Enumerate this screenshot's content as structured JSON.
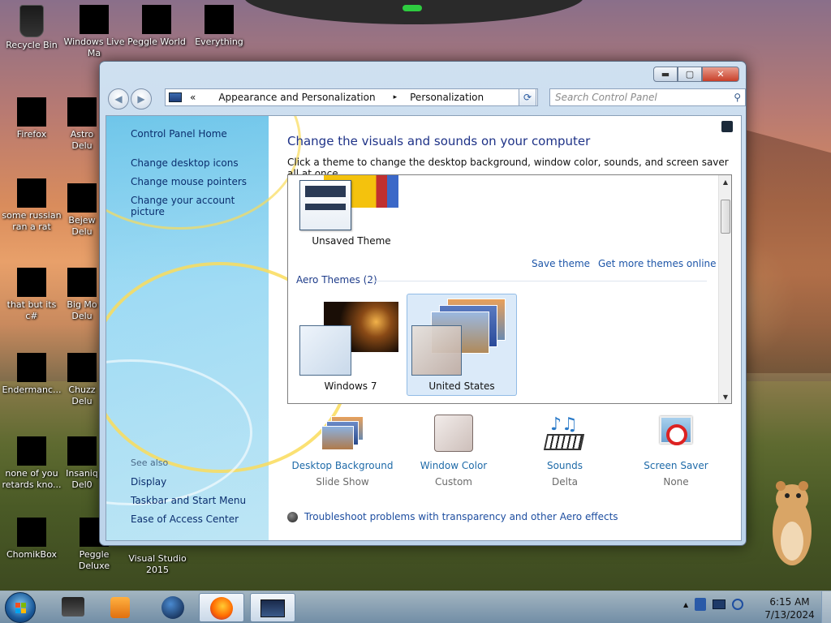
{
  "desktop": {
    "icons": [
      {
        "label": "Recycle Bin"
      },
      {
        "label": "Windows Live Ma"
      },
      {
        "label": "Peggle World"
      },
      {
        "label": "Everything"
      },
      {
        "label": "Firefox"
      },
      {
        "label": "Astro Delu"
      },
      {
        "label": "some russian ran a rat"
      },
      {
        "label": "Bejew Delu"
      },
      {
        "label": "that but its c#"
      },
      {
        "label": "Big Mo Delu"
      },
      {
        "label": "Endermanc..."
      },
      {
        "label": "Chuzz Delu"
      },
      {
        "label": "none of you retards kno..."
      },
      {
        "label": "Insaniq Del0"
      },
      {
        "label": "ChomikBox"
      },
      {
        "label": "Peggle Deluxe"
      },
      {
        "label": "Visual Studio 2015"
      }
    ]
  },
  "window": {
    "controls": {
      "minimize": "▬",
      "maximize": "▢",
      "close": "✕"
    },
    "nav": {
      "back": "◀",
      "forward": "▶"
    },
    "address": {
      "overflow": "«",
      "crumb1": "Appearance and Personalization",
      "sep": "▸",
      "crumb2": "Personalization",
      "dropdown": "▼"
    },
    "refresh": "⟳",
    "search": {
      "placeholder": "Search Control Panel",
      "icon": "⚲"
    },
    "left": {
      "home": "Control Panel Home",
      "links": [
        "Change desktop icons",
        "Change mouse pointers",
        "Change your account picture"
      ],
      "see_also": "See also",
      "see_links": [
        "Display",
        "Taskbar and Start Menu",
        "Ease of Access Center"
      ]
    },
    "main": {
      "title": "Change the visuals and sounds on your computer",
      "subtitle": "Click a theme to change the desktop background, window color, sounds, and screen saver all at once.",
      "unsaved_theme": "Unsaved Theme",
      "save_theme": "Save theme",
      "get_more": "Get more themes online",
      "aero_head": "Aero Themes (2)",
      "theme1": "Windows 7",
      "theme2": "United States",
      "bottom": [
        {
          "name": "Desktop Background",
          "value": "Slide Show"
        },
        {
          "name": "Window Color",
          "value": "Custom"
        },
        {
          "name": "Sounds",
          "value": "Delta"
        },
        {
          "name": "Screen Saver",
          "value": "None"
        }
      ],
      "troubleshoot": "Troubleshoot problems with transparency and other Aero effects"
    }
  },
  "taskbar": {
    "tray_arrow": "▲",
    "time": "6:15 AM",
    "date": "7/13/2024"
  }
}
